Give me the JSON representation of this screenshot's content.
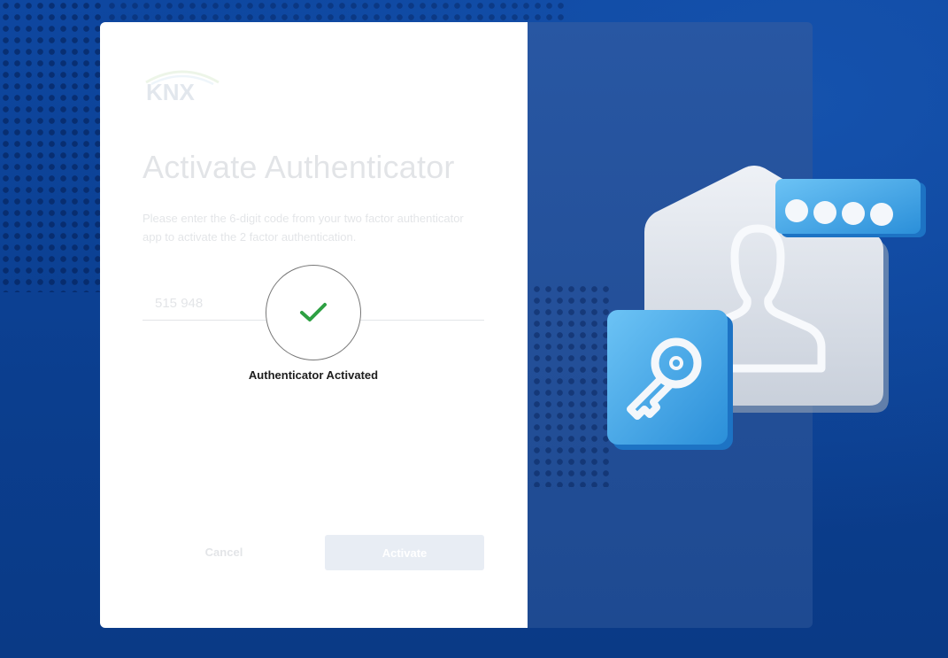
{
  "brand": {
    "logo_text": "KNX"
  },
  "form": {
    "title": "Activate Authenticator",
    "description": "Please enter the 6-digit code from your two factor authenticator app to activate the 2 factor authentication.",
    "code_value": "515 948"
  },
  "actions": {
    "cancel_label": "Cancel",
    "activate_label": "Activate"
  },
  "status": {
    "message": "Authenticator Activated",
    "icon": "check-icon"
  },
  "colors": {
    "background": "#0c3f8c",
    "panel_right": "#234f98",
    "check": "#2ea043",
    "tile_blue": "#3aa3e8"
  }
}
